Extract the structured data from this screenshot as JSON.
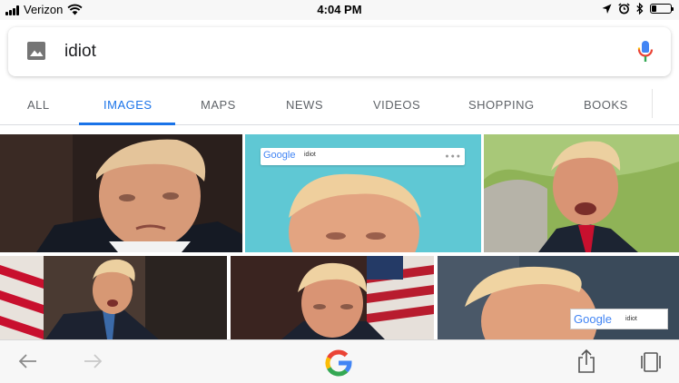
{
  "status_bar": {
    "carrier": "Verizon",
    "time": "4:04 PM",
    "battery_level": 0.25
  },
  "search": {
    "query": "idiot",
    "image_icon": "image-search-icon",
    "mic_icon": "microphone-icon"
  },
  "tabs": [
    {
      "label": "ALL",
      "active": false
    },
    {
      "label": "IMAGES",
      "active": true
    },
    {
      "label": "MAPS",
      "active": false
    },
    {
      "label": "NEWS",
      "active": false
    },
    {
      "label": "VIDEOS",
      "active": false
    },
    {
      "label": "SHOPPING",
      "active": false
    },
    {
      "label": "BOOKS",
      "active": false
    }
  ],
  "results": {
    "thumb_search_brand": "Google",
    "thumb_search_query": "idiot",
    "thumb_search_brand_2": "Google",
    "thumb_search_query_2": "idiot"
  },
  "colors": {
    "accent": "#1a73e8",
    "google_blue": "#4285f4",
    "google_red": "#ea4335",
    "google_yellow": "#fbbc05",
    "google_green": "#34a853"
  },
  "bottom_bar": {
    "back_icon": "arrow-left-icon",
    "forward_icon": "arrow-right-icon",
    "home_icon": "google-g-logo",
    "share_icon": "share-icon",
    "tabs_icon": "tabs-icon"
  }
}
